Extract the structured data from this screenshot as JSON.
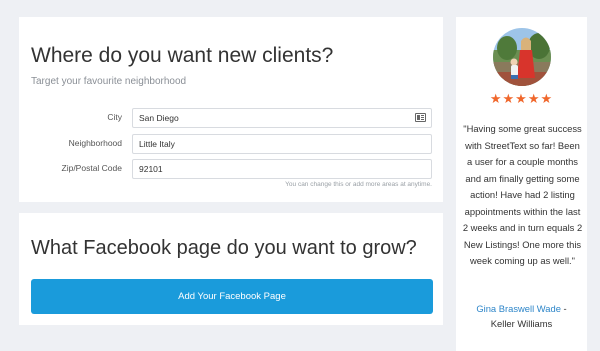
{
  "clients_card": {
    "title": "Where do you want new clients?",
    "subtitle": "Target your favourite neighborhood",
    "fields": {
      "city": {
        "label": "City",
        "value": "San Diego"
      },
      "neighborhood": {
        "label": "Neighborhood",
        "value": "Little Italy"
      },
      "zip": {
        "label": "Zip/Postal Code",
        "value": "92101"
      }
    },
    "help_text": "You can change this or add more areas at anytime."
  },
  "facebook_card": {
    "title": "What Facebook page do you want to grow?",
    "button_label": "Add Your Facebook Page",
    "button_color": "#1a9bdb"
  },
  "testimonial": {
    "rating": 5,
    "stars": "★★★★★",
    "star_color": "#f0672c",
    "quote": "\"Having some great success with StreetText so far! Been a user for a couple months and am finally getting some action! Have had 2 listing appointments within the last 2 weeks and in turn equals 2 New Listings! One more this week coming up as well.\"",
    "author_name": "Gina Braswell Wade",
    "author_separator": " -",
    "author_company": "Keller Williams",
    "link_color": "#2e86c9"
  }
}
